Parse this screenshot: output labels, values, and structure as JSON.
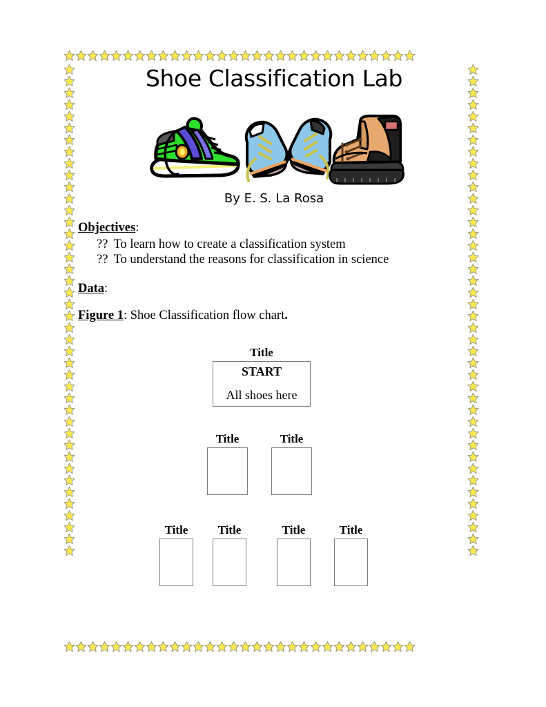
{
  "document": {
    "title": "Shoe Classification Lab",
    "byline": "By E. S. La Rosa"
  },
  "objectives": {
    "heading": "Objectives",
    "heading_colon": ":",
    "bullet_marker": "??",
    "items": [
      "To learn how to create a classification system",
      "To understand the reasons for classification in science"
    ]
  },
  "data_section": {
    "heading": "Data",
    "heading_colon": ":"
  },
  "figure": {
    "label": "Figure 1",
    "label_colon": ":",
    "caption": " Shoe Classification flow chart",
    "caption_period": "."
  },
  "flowchart": {
    "start_node": {
      "title": "Title",
      "primary_text": "START",
      "secondary_text": "All shoes here"
    },
    "level_1": [
      {
        "title": "Title",
        "text": ""
      },
      {
        "title": "Title",
        "text": ""
      }
    ],
    "level_2": [
      {
        "title": "Title",
        "text": ""
      },
      {
        "title": "Title",
        "text": ""
      },
      {
        "title": "Title",
        "text": ""
      },
      {
        "title": "Title",
        "text": ""
      }
    ]
  },
  "decoration": {
    "border_icon": "star-icon",
    "border_star_fill": "#FFE94D",
    "border_star_stroke": "#9a9a8a",
    "clipart": [
      "green-sneaker-icon",
      "blue-running-shoes-icon",
      "brown-work-boot-icon"
    ]
  }
}
